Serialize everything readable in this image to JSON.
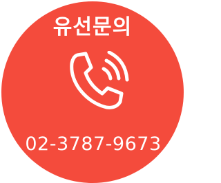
{
  "contact": {
    "title": "유선문의",
    "phone_number": "02-3787-9673",
    "icon": "phone-ringing-icon",
    "colors": {
      "background": "#f44b3c",
      "foreground": "#ffffff"
    }
  }
}
